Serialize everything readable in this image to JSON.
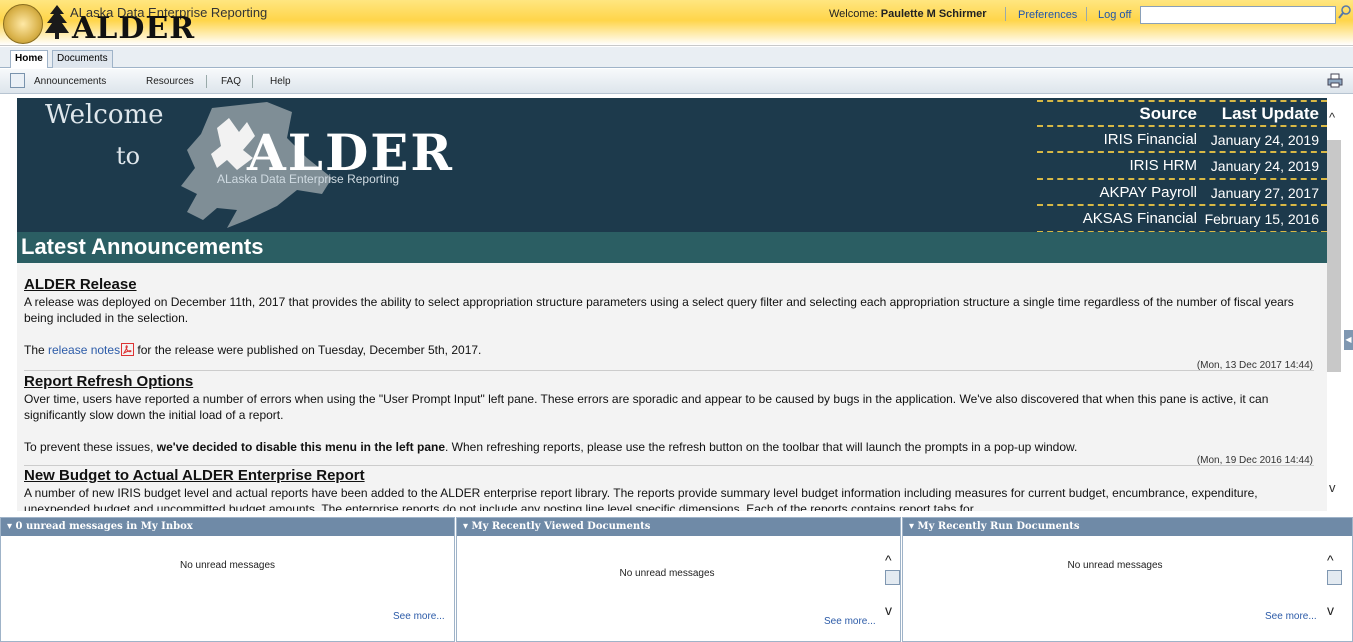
{
  "header": {
    "app_subtitle": "ALaska Data Enterprise Reporting",
    "app_name": "ALDER",
    "welcome_label": "Welcome:",
    "user_name": "Paulette M Schirmer",
    "preferences": "Preferences",
    "logoff": "Log off",
    "search_value": ""
  },
  "tabs": [
    {
      "label": "Home",
      "active": true
    },
    {
      "label": "Documents",
      "active": false
    }
  ],
  "toolbar": {
    "items": [
      "Announcements",
      "Resources",
      "FAQ",
      "Help"
    ]
  },
  "banner": {
    "welcome": "Welcome",
    "to": "to",
    "alder": "ALDER",
    "subtitle": "ALaska Data Enterprise Reporting"
  },
  "sources": {
    "header": {
      "name": "Source",
      "date": "Last Update"
    },
    "rows": [
      {
        "name": "IRIS Financial",
        "date": "January 24, 2019"
      },
      {
        "name": "IRIS HRM",
        "date": "January 24, 2019"
      },
      {
        "name": "AKPAY Payroll",
        "date": "January 27, 2017"
      },
      {
        "name": "AKSAS Financial",
        "date": "February 15, 2016"
      }
    ]
  },
  "announcements": {
    "title": "Latest Announcements",
    "items": [
      {
        "heading": "ALDER Release",
        "body1": "A release was deployed on December 11th, 2017 that provides the ability to select appropriation structure parameters using a select query filter and selecting each appropriation structure a single time regardless of the number of fiscal years being included in the selection.",
        "body2_pre": "The ",
        "body2_link": "release notes",
        "body2_post": " for the release were published on Tuesday, December 5th, 2017.",
        "timestamp": "(Mon, 13 Dec 2017 14:44)"
      },
      {
        "heading": "Report Refresh Options",
        "body1": "Over time, users have reported a number of errors when using the \"User Prompt Input\" left pane. These errors are sporadic and appear to be caused by bugs in the application. We've also discovered that when this pane is active, it can significantly slow down the initial load of a report.",
        "body2_pre": "To prevent these issues, ",
        "body2_bold": "we've decided to disable this menu in the left pane",
        "body2_post": ". When refreshing reports, please use the refresh button on the toolbar that will launch the prompts in a pop-up window.",
        "timestamp": "(Mon, 19 Dec 2016 14:44)"
      },
      {
        "heading": "New Budget to Actual ALDER Enterprise Report",
        "body1": "A number of new IRIS budget level and actual reports have been added to the ALDER enterprise report library. The reports provide summary level budget information including measures for current budget, encumbrance, expenditure, unexpended budget and uncommitted budget amounts. The enterprise reports do not include any posting line level specific dimensions. Each of the reports contains report tabs for"
      }
    ]
  },
  "panels": [
    {
      "title": "0 unread messages in My Inbox",
      "message": "No unread messages",
      "see_more": "See more..."
    },
    {
      "title": "My Recently Viewed Documents",
      "message": "No unread messages",
      "see_more": "See more..."
    },
    {
      "title": "My Recently Run Documents",
      "message": "No unread messages",
      "see_more": "See more..."
    }
  ],
  "colors": {
    "banner": "#1d3a4c",
    "announcement_bar": "#2b5e63",
    "panel_header": "#6f8aa7",
    "link": "#2c5ba8"
  }
}
